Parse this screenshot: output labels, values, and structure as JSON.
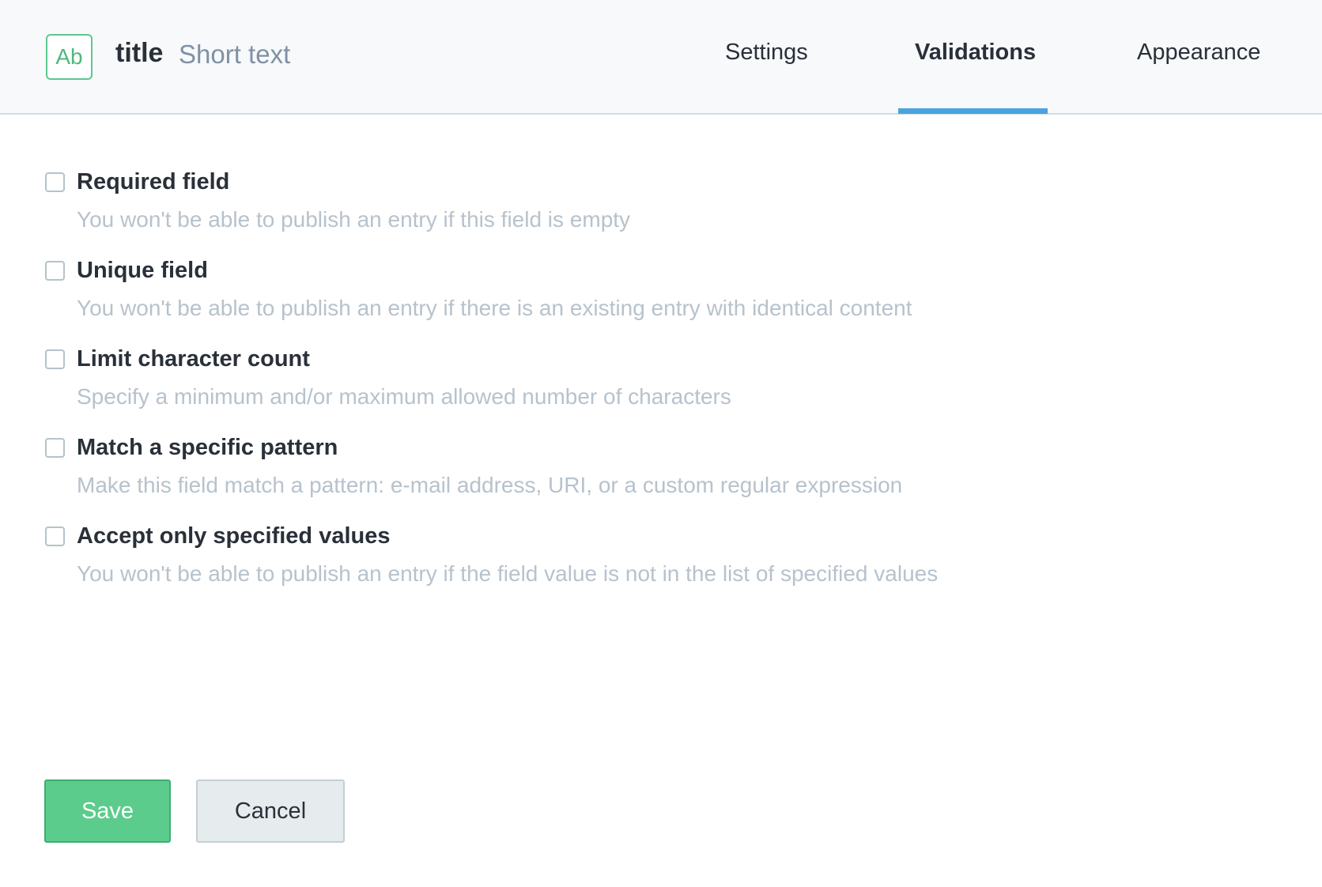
{
  "header": {
    "icon_text": "Ab",
    "field_name": "title",
    "field_type": "Short text",
    "tabs": [
      {
        "label": "Settings",
        "active": false
      },
      {
        "label": "Validations",
        "active": true
      },
      {
        "label": "Appearance",
        "active": false
      }
    ]
  },
  "validations": [
    {
      "label": "Required field",
      "description": "You won't be able to publish an entry if this field is empty",
      "checked": false
    },
    {
      "label": "Unique field",
      "description": "You won't be able to publish an entry if there is an existing entry with identical content",
      "checked": false
    },
    {
      "label": "Limit character count",
      "description": "Specify a minimum and/or maximum allowed number of characters",
      "checked": false
    },
    {
      "label": "Match a specific pattern",
      "description": "Make this field match a pattern: e-mail address, URI, or a custom regular expression",
      "checked": false
    },
    {
      "label": "Accept only specified values",
      "description": "You won't be able to publish an entry if the field value is not in the list of specified values",
      "checked": false
    }
  ],
  "actions": {
    "save_label": "Save",
    "cancel_label": "Cancel"
  },
  "colors": {
    "accent_green": "#5ccc8c",
    "tab_indicator": "#4aa3e1",
    "header_bg": "#f7f9fa"
  }
}
